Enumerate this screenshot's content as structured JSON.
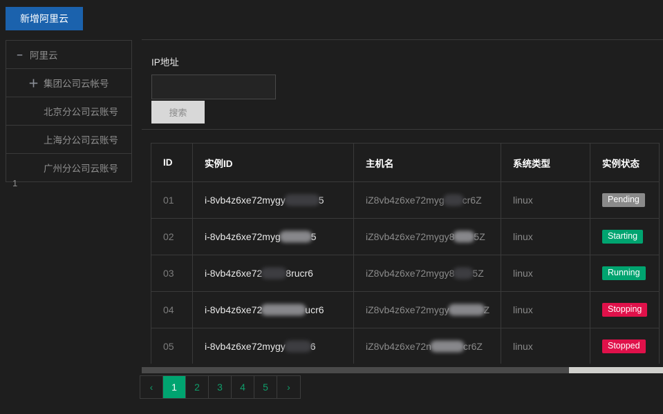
{
  "toolbar": {
    "add_button_label": "新增阿里云"
  },
  "sidebar": {
    "footnote": "1",
    "items": [
      {
        "label": "阿里云",
        "icon": "minus-icon",
        "icon_glyph": "–",
        "level": 0
      },
      {
        "label": "集团公司云帐号",
        "icon": "plus-icon",
        "icon_glyph": "＋",
        "level": 1
      },
      {
        "label": "北京分公司云账号",
        "icon": "none",
        "icon_glyph": "",
        "level": 1
      },
      {
        "label": "上海分公司云账号",
        "icon": "none",
        "icon_glyph": "",
        "level": 1
      },
      {
        "label": "广州分公司云账号",
        "icon": "none",
        "icon_glyph": "",
        "level": 1
      }
    ]
  },
  "search": {
    "label": "IP地址",
    "value": "",
    "placeholder": "",
    "button_label": "搜索"
  },
  "table": {
    "columns": [
      "ID",
      "实例ID",
      "主机名",
      "系统类型",
      "实例状态"
    ],
    "rows": [
      {
        "id": "01",
        "instance_id_prefix": "i-8vb4z6xe72mygy",
        "instance_id_suffix": "5",
        "redact_width": 48,
        "redact_tone": "dim",
        "hostname_prefix": "iZ8vb4z6xe72myg",
        "hostname_suffix": "cr6Z",
        "host_redact_width": 26,
        "host_redact_tone": "dim",
        "os": "linux",
        "state": "Pending",
        "state_color": "#8a8a8a"
      },
      {
        "id": "02",
        "instance_id_prefix": "i-8vb4z6xe72myg",
        "instance_id_suffix": "5",
        "redact_width": 44,
        "redact_tone": "light",
        "hostname_prefix": "iZ8vb4z6xe72mygy8",
        "hostname_suffix": "5Z",
        "host_redact_width": 28,
        "host_redact_tone": "light",
        "os": "linux",
        "state": "Starting",
        "state_color": "#00a470"
      },
      {
        "id": "03",
        "instance_id_prefix": "i-8vb4z6xe72",
        "instance_id_suffix": "8rucr6",
        "redact_width": 34,
        "redact_tone": "dim",
        "hostname_prefix": "iZ8vb4z6xe72mygy8",
        "hostname_suffix": "5Z",
        "host_redact_width": 26,
        "host_redact_tone": "dim",
        "os": "linux",
        "state": "Running",
        "state_color": "#00a470"
      },
      {
        "id": "04",
        "instance_id_prefix": "i-8vb4z6xe72",
        "instance_id_suffix": "ucr6",
        "redact_width": 62,
        "redact_tone": "light",
        "hostname_prefix": "iZ8vb4z6xe72mygy",
        "hostname_suffix": "Z",
        "host_redact_width": 50,
        "host_redact_tone": "light",
        "os": "linux",
        "state": "Stopping",
        "state_color": "#e0114a"
      },
      {
        "id": "05",
        "instance_id_prefix": "i-8vb4z6xe72mygy",
        "instance_id_suffix": "6",
        "redact_width": 36,
        "redact_tone": "dim",
        "hostname_prefix": "iZ8vb4z6xe72n",
        "hostname_suffix": "cr6Z",
        "host_redact_width": 46,
        "host_redact_tone": "light",
        "os": "linux",
        "state": "Stopped",
        "state_color": "#e0114a"
      }
    ]
  },
  "pagination": {
    "prev_label": "‹",
    "next_label": "›",
    "pages": [
      "1",
      "2",
      "3",
      "4",
      "5"
    ],
    "active_index": 0
  },
  "scrollbar": {
    "thumb_percent": 82
  },
  "colors": {
    "accent_green": "#00a470",
    "accent_blue": "#1b62ad",
    "danger_red": "#e0114a",
    "neutral_gray": "#8a8a8a"
  }
}
